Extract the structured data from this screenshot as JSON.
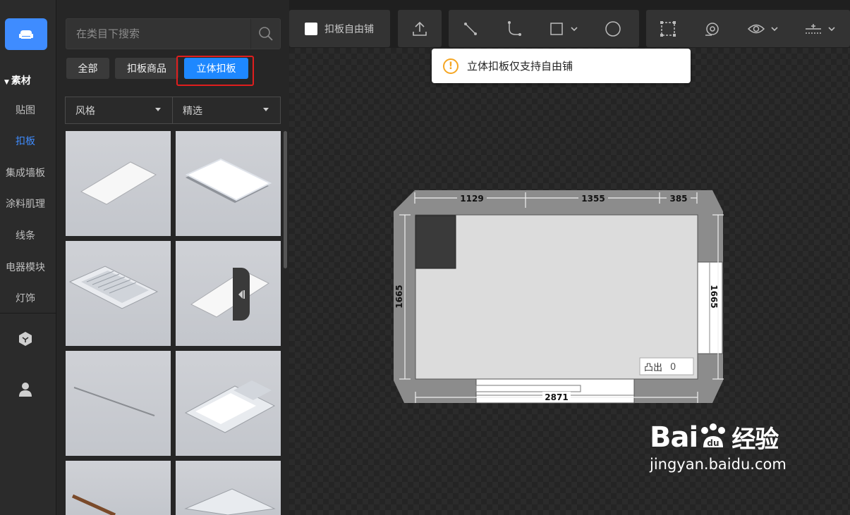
{
  "rail": {
    "section_label": "素材",
    "items": [
      {
        "label": "贴图",
        "active": false
      },
      {
        "label": "扣板",
        "active": true
      },
      {
        "label": "集成墙板",
        "active": false
      },
      {
        "label": "涂料肌理",
        "active": false
      },
      {
        "label": "线条",
        "active": false
      },
      {
        "label": "电器模块",
        "active": false
      },
      {
        "label": "灯饰",
        "active": false
      }
    ],
    "icons": [
      "sofa-icon",
      "cube-icon",
      "user-icon"
    ]
  },
  "panel": {
    "search_placeholder": "在类目下搜索",
    "tabs": [
      {
        "label": "全部",
        "active": false
      },
      {
        "label": "扣板商品",
        "active": false
      },
      {
        "label": "立体扣板",
        "active": true
      }
    ],
    "filters": [
      {
        "label": "风格"
      },
      {
        "label": "精选"
      }
    ],
    "thumbnails": [
      "flat-panel",
      "light-panel",
      "vent-module",
      "flat-panel",
      "line-strip",
      "light-vent-module",
      "wood-strip",
      "vent-module"
    ]
  },
  "toolbar": {
    "free_tile_label": "扣板自由铺",
    "free_tile_checked": false,
    "tools": [
      "upload-icon",
      "line-tool-icon",
      "arc-tool-icon",
      "rectangle-tool-icon",
      "circle-tool-icon",
      "region-select-icon",
      "camera-view-icon",
      "eye-icon",
      "level-icon"
    ]
  },
  "toast": {
    "message": "立体扣板仅支持自由铺"
  },
  "floorplan": {
    "dim_top_1": "1129",
    "dim_top_2": "1355",
    "dim_top_3": "385",
    "dim_left": "1665",
    "dim_right": "1665",
    "dim_bottom": "2871",
    "protrude_label": "凸出",
    "protrude_value": "0"
  },
  "watermark": {
    "brand": "Bai",
    "brand_cn": "经验",
    "url": "jingyan.baidu.com"
  },
  "colors": {
    "accent": "#1e88ff",
    "highlight_border": "#e01e1e",
    "warning": "#f5a623"
  }
}
